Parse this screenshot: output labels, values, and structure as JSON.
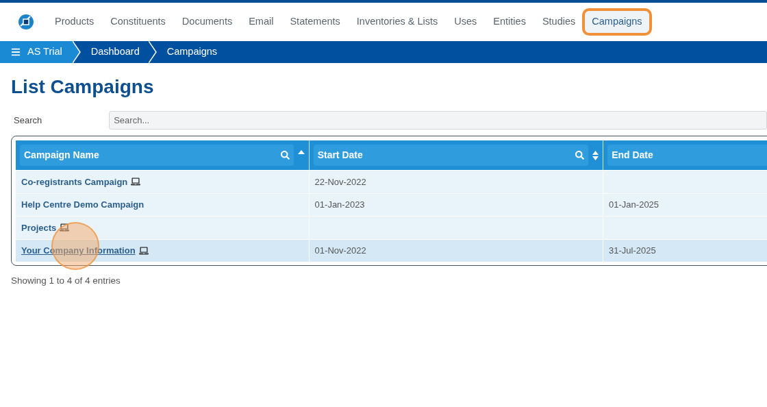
{
  "nav": {
    "items": [
      {
        "label": "Products",
        "selected": false
      },
      {
        "label": "Constituents",
        "selected": false
      },
      {
        "label": "Documents",
        "selected": false
      },
      {
        "label": "Email",
        "selected": false
      },
      {
        "label": "Statements",
        "selected": false
      },
      {
        "label": "Inventories & Lists",
        "selected": false
      },
      {
        "label": "Uses",
        "selected": false
      },
      {
        "label": "Entities",
        "selected": false
      },
      {
        "label": "Studies",
        "selected": false
      },
      {
        "label": "Campaigns",
        "selected": true
      }
    ]
  },
  "breadcrumb": [
    "AS Trial",
    "Dashboard",
    "Campaigns"
  ],
  "title": "List Campaigns",
  "search": {
    "label": "Search",
    "placeholder": "Search..."
  },
  "table": {
    "columns": [
      {
        "label": "Campaign Name",
        "sortable": true,
        "sorted": true
      },
      {
        "label": "Start Date",
        "sortable": true,
        "sorted": false
      },
      {
        "label": "End Date"
      }
    ],
    "rows": [
      {
        "name": "Co-registrants Campaign",
        "device_icon": true,
        "start": "22-Nov-2022",
        "highlighted": false
      },
      {
        "name": "Help Centre Demo Campaign",
        "device_icon": false,
        "start": "01-Jan-2023",
        "end": "01-Jan-2025",
        "highlighted": false
      },
      {
        "name": "Projects",
        "device_icon": true,
        "highlighted": false
      },
      {
        "name": "Your Company Information",
        "device_icon": true,
        "start": "01-Nov-2022",
        "end": "31-Jul-2025",
        "highlighted": true
      }
    ]
  },
  "footer": "Showing 1 to 4 of 4 entries"
}
